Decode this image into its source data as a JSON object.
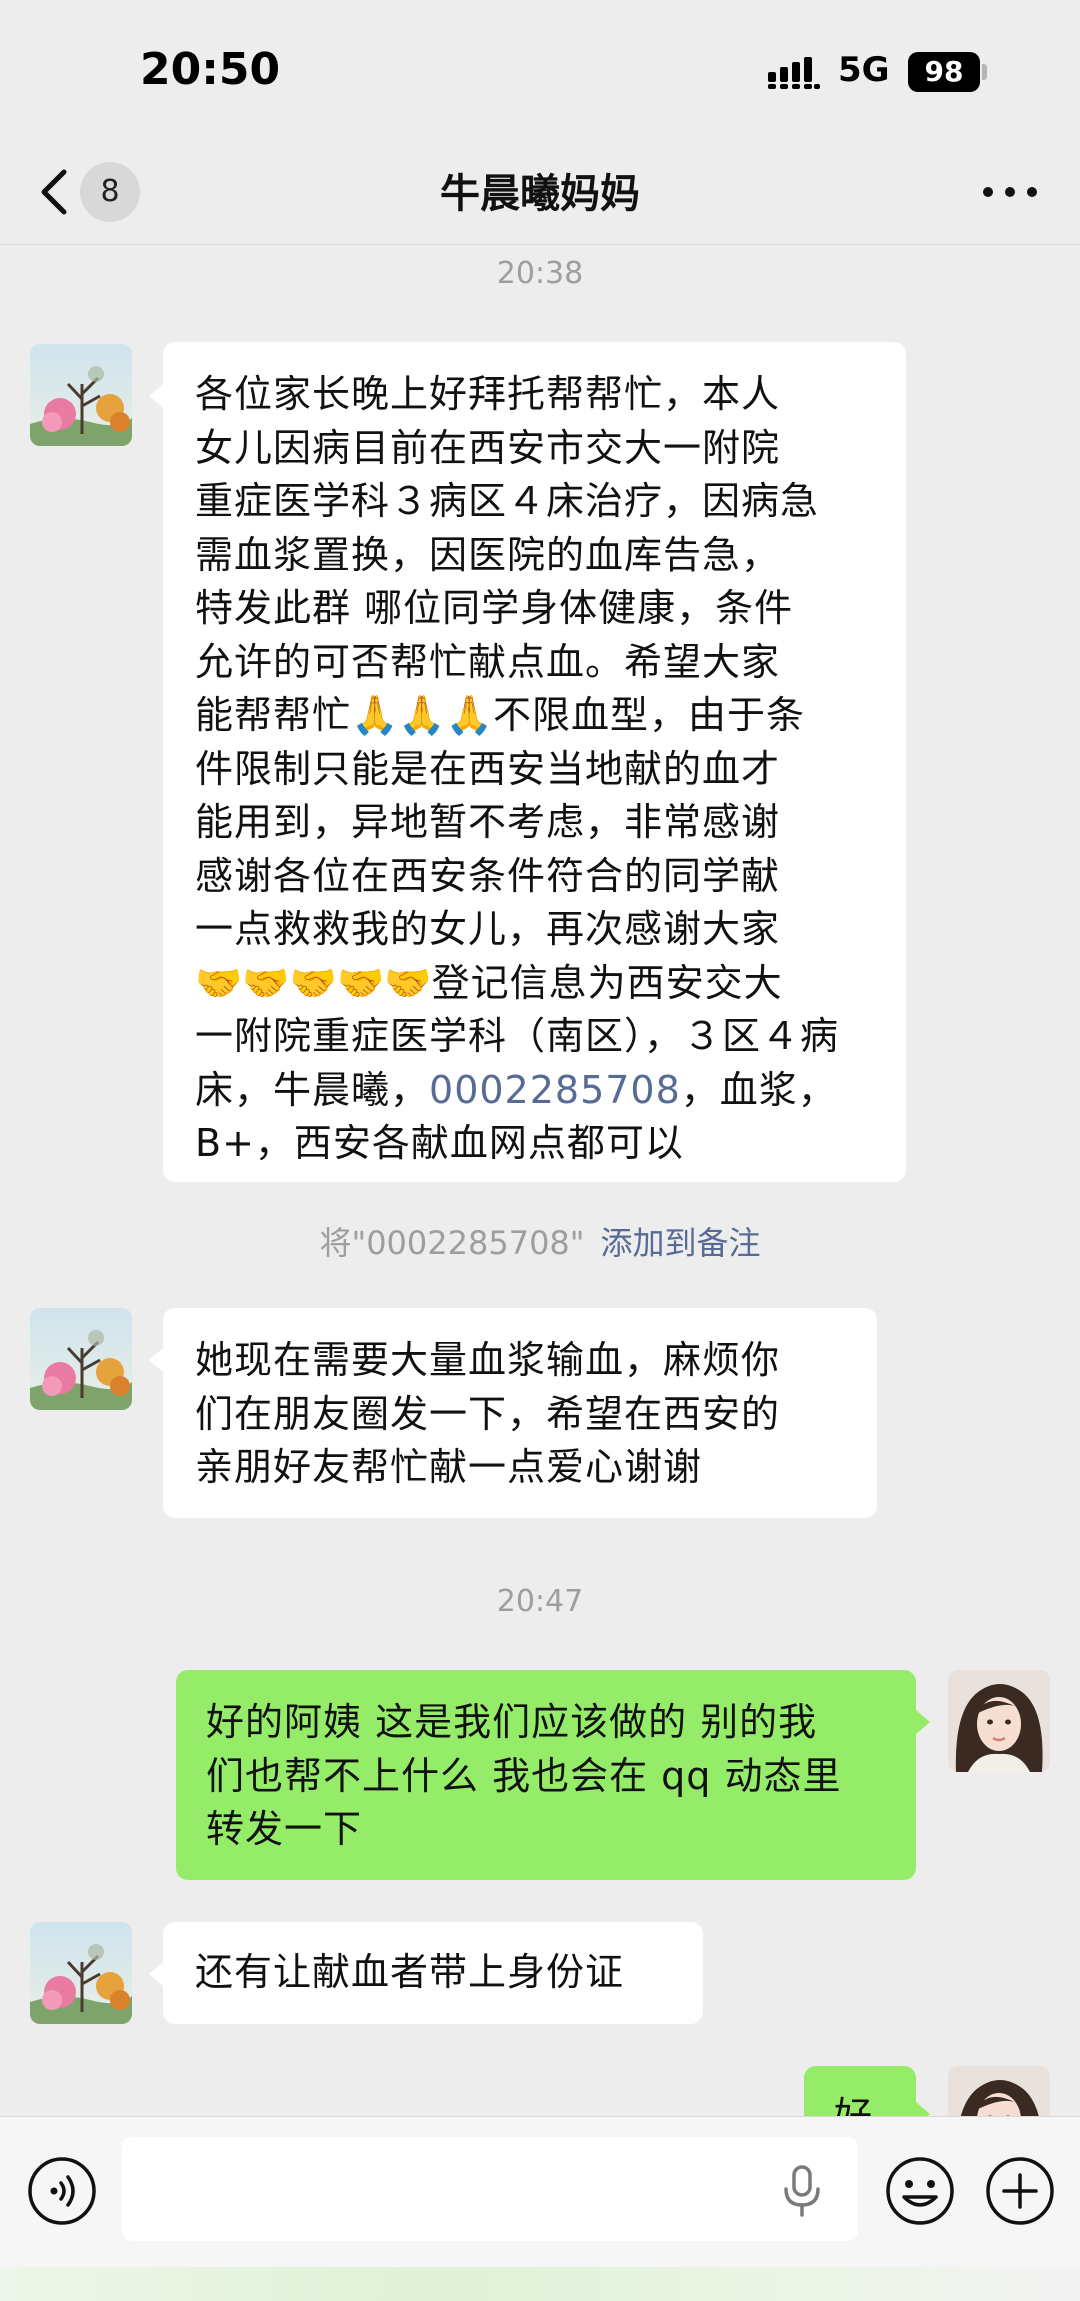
{
  "status_bar": {
    "time": "20:50",
    "network": "5G",
    "battery": "98"
  },
  "nav": {
    "unread_count": "8",
    "title": "牛晨曦妈妈"
  },
  "timestamps": {
    "first": "20:38",
    "second": "20:47"
  },
  "messages": {
    "m1": {
      "line1": "各位家长晚上好拜托帮帮忙，本人",
      "line2": "女儿因病目前在西安市交大一附院",
      "line3": "重症医学科３病区４床治疗，因病急",
      "line4": "需血浆置换，因医院的血库告急，",
      "line5": "特发此群 哪位同学身体健康，条件",
      "line6": "允许的可否帮忙献点血。希望大家",
      "line7a": "能帮帮忙",
      "line7_emoji": "🙏🙏🙏",
      "line7b": "不限血型，由于条",
      "line8": "件限制只能是在西安当地献的血才",
      "line9": "能用到，异地暂不考虑，非常感谢",
      "line10": "感谢各位在西安条件符合的同学献",
      "line11": "一点救救我的女儿，再次感谢大家",
      "line12_emoji": "🤝🤝🤝🤝🤝",
      "line12b": "登记信息为西安交大",
      "line13": "一附院重症医学科（南区），３区４病",
      "line14a": "床，牛晨曦，",
      "line14_link": "0002285708",
      "line14b": "，血浆，",
      "line15": "B+，西安各献血网点都可以"
    },
    "remark_hint": {
      "prefix": "将\"0002285708\"",
      "action": "添加到备注"
    },
    "m2": {
      "line1": "她现在需要大量血浆输血，麻烦你",
      "line2": "们在朋友圈发一下，希望在西安的",
      "line3": "亲朋好友帮忙献一点爱心谢谢"
    },
    "m3": {
      "line1": "好的阿姨 这是我们应该做的 别的我",
      "line2": "们也帮不上什么 我也会在 qq 动态里",
      "line3": "转发一下"
    },
    "m4": {
      "line1": "还有让献血者带上身份证"
    },
    "m5": {
      "line1": "好"
    }
  },
  "input_bar": {
    "placeholder": ""
  },
  "colors": {
    "background": "#ededed",
    "incoming_bubble": "#ffffff",
    "outgoing_bubble": "#95ec69",
    "link": "#576b95",
    "timestamp": "#9e9e9e"
  },
  "icons": {
    "back": "chevron-left-icon",
    "more": "more-dots-icon",
    "voice": "voice-icon",
    "mic": "mic-icon",
    "emoji": "emoji-icon",
    "plus": "plus-icon"
  }
}
